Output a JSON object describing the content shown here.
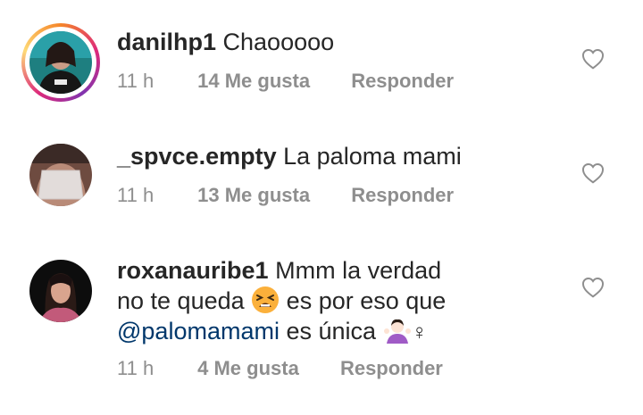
{
  "comments": [
    {
      "username": "danilhp1",
      "text": "Chaooooo",
      "time": "11 h",
      "likes": "14 Me gusta",
      "reply_label": "Responder",
      "has_story_ring": true
    },
    {
      "username": "_spvce.empty",
      "text": "La paloma mami",
      "time": "11 h",
      "likes": "13 Me gusta",
      "reply_label": "Responder",
      "has_story_ring": false
    },
    {
      "username": "roxanauribe1",
      "text_part1": "Mmm la verdad no te queda",
      "text_part2": "es por eso que",
      "mention": "@palomamami",
      "text_part3": "es única",
      "emoji_1": "😫",
      "emoji_2": "🤷🏻‍♀️",
      "time": "11 h",
      "likes": "4 Me gusta",
      "reply_label": "Responder",
      "has_story_ring": false
    }
  ],
  "colors": {
    "text": "#262626",
    "meta": "#8e8e8e",
    "mention": "#00376b",
    "ring": [
      "#f58529",
      "#dd2a7b",
      "#8134af"
    ]
  }
}
